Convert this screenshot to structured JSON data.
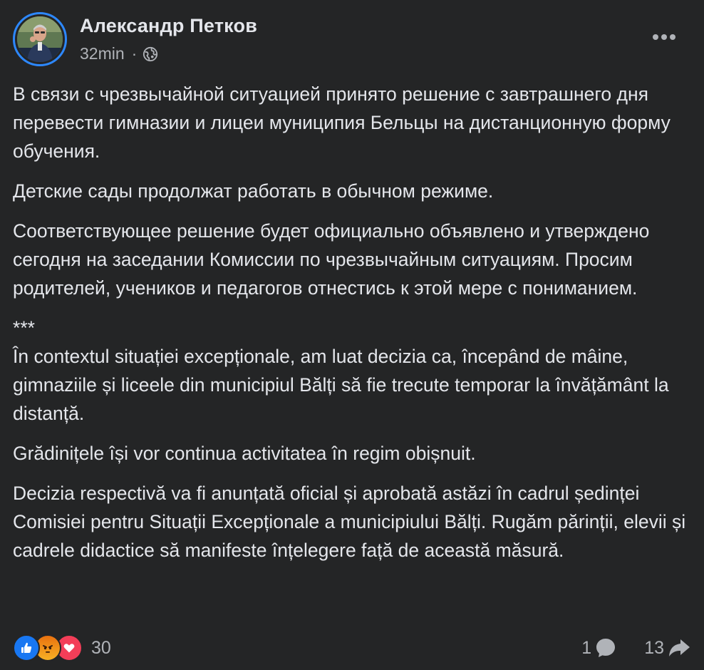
{
  "post": {
    "author": "Александр Петков",
    "time": "32min",
    "separator": "·",
    "privacy_icon": "globe-icon",
    "more_icon": "more-options-icon",
    "paragraphs": [
      "В связи с чрезвычайной ситуацией принято решение с завтрашнего дня перевести гимназии и лицеи муниципия Бельцы на дистанционную форму обучения.",
      "Детские сады продолжат работать в обычном режиме.",
      "Соответствующее решение будет официально объявлено и утверждено сегодня на заседании Комиссии по чрезвычайным ситуациям. Просим родителей, учеников и педагогов отнестись к этой мере с пониманием.",
      "***",
      "În contextul situației excepționale, am luat decizia ca, începând de mâine, gimnaziile și liceele din municipiul Bălți să fie trecute temporar la învățământ la distanță.",
      "Grădinițele își vor continua activitatea în regim obișnuit.",
      "Decizia respectivă va fi anunțată oficial și aprobată astăzi în cadrul ședinței Comisiei pentru Situații Excepționale a municipiului Bălți. Rugăm părinții, elevii și cadrele didactice să manifeste înțelegere față de această măsură."
    ]
  },
  "footer": {
    "reactions": [
      "like-icon",
      "angry-icon",
      "love-icon"
    ],
    "reaction_count": "30",
    "comments_count": "1",
    "comments_icon": "comment-icon",
    "shares_count": "13",
    "shares_icon": "share-icon"
  },
  "colors": {
    "background": "#242526",
    "text": "#e4e6eb",
    "secondary_text": "#b0b3b8",
    "avatar_ring": "#2d88ff",
    "like": "#1877f2",
    "love": "#f33e58",
    "angry": "#f7b125"
  }
}
